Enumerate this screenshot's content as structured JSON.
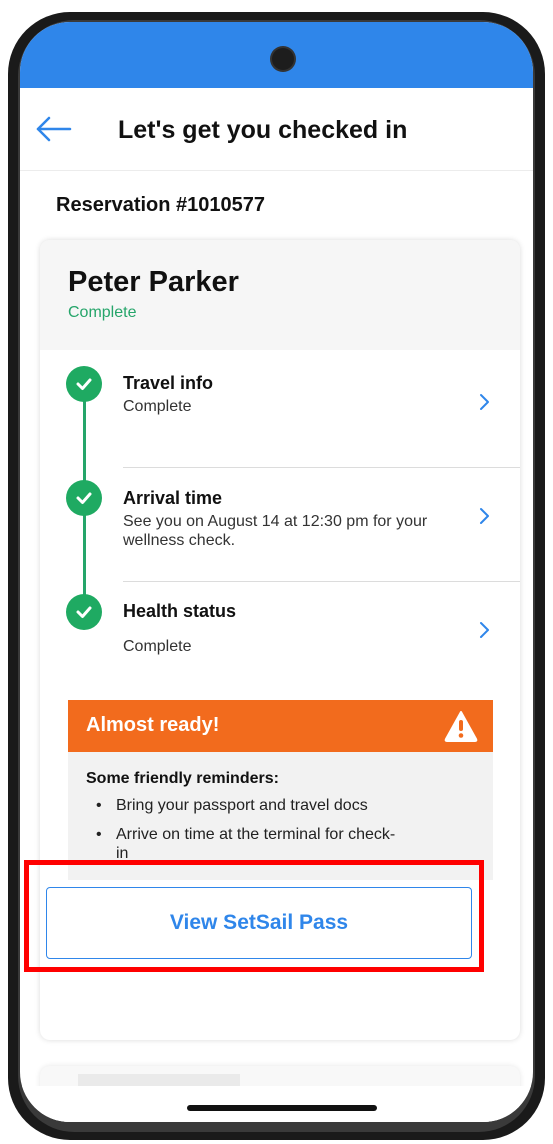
{
  "header": {
    "title": "Let's get you checked in"
  },
  "reservation": {
    "label": "Reservation #1010577"
  },
  "guest": {
    "name": "Peter Parker",
    "status": "Complete"
  },
  "steps": [
    {
      "title": "Travel info",
      "subtitle": "Complete"
    },
    {
      "title": "Arrival time",
      "subtitle": "See you on August 14 at 12:30 pm for your wellness check."
    },
    {
      "title": "Health status",
      "subtitle": "Complete"
    }
  ],
  "alert": {
    "title": "Almost ready!",
    "reminder_heading": "Some friendly reminders:",
    "reminders": [
      "Bring your passport and travel docs",
      "Arrive on time at the terminal for check-in"
    ]
  },
  "action": {
    "pass_button_label": "View SetSail Pass"
  },
  "colors": {
    "brand_blue": "#2f86ea",
    "success_green": "#1faa62",
    "alert_orange": "#f26b1d",
    "highlight_red": "#ff0000"
  },
  "icons": {
    "back": "arrow-left-icon",
    "check": "check-circle-icon",
    "chevron": "chevron-right-icon",
    "warning": "warning-triangle-icon"
  }
}
